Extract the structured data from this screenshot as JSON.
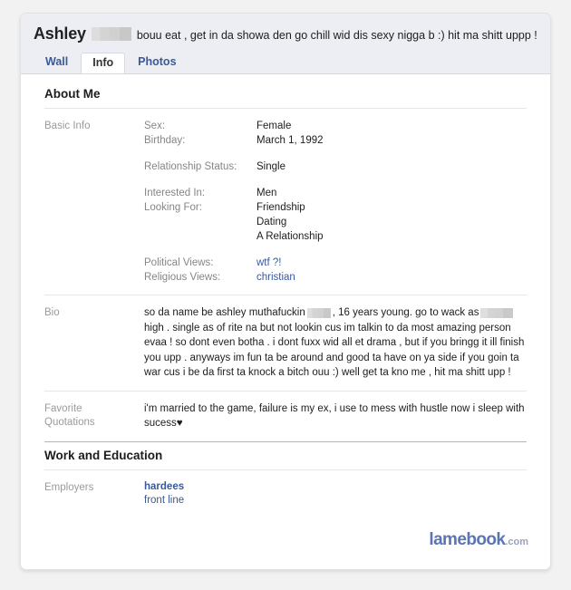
{
  "profile": {
    "name": "Ashley",
    "status_text": "bouu eat , get in da showa den go chill wid dis sexy nigga b :) hit ma shitt uppp !"
  },
  "tabs": [
    {
      "label": "Wall",
      "active": false
    },
    {
      "label": "Info",
      "active": true
    },
    {
      "label": "Photos",
      "active": false
    }
  ],
  "sections": {
    "about_me": {
      "title": "About Me",
      "basic_info": {
        "label": "Basic Info",
        "fields": [
          {
            "key": "Sex:",
            "value": "Female"
          },
          {
            "key": "Birthday:",
            "value": "March 1, 1992"
          },
          {
            "key": "Relationship Status:",
            "value": "Single"
          },
          {
            "key": "Interested In:",
            "value": "Men"
          },
          {
            "key": "Looking For:",
            "value": "Friendship"
          },
          {
            "key": "",
            "value": "Dating"
          },
          {
            "key": "",
            "value": "A Relationship"
          },
          {
            "key": "Political Views:",
            "value": "wtf ?!"
          },
          {
            "key": "Religious Views:",
            "value": "christian"
          }
        ]
      },
      "bio": {
        "label": "Bio",
        "part1": "so da name be ashley muthafuckin",
        "part2": ", 16 years young. go to wack as",
        "part3": "high . single as of rite na but not lookin cus im talkin to da most amazing person evaa ! so dont even botha . i dont fuxx wid all et drama , but if you bringg it ill finish you upp . anyways im fun ta be around and good ta have on ya side if you goin ta war cus i be da first ta knock a bitch ouu :) well get ta kno me , hit ma shitt upp !"
      },
      "favorite_quotations": {
        "label_line1": "Favorite",
        "label_line2": "Quotations",
        "text": "i'm married to the game, failure is my ex, i use to mess with hustle now i sleep with sucess♥"
      }
    },
    "work_and_education": {
      "title": "Work and Education",
      "employers": {
        "label": "Employers",
        "name": "hardees",
        "position": "front line"
      }
    }
  },
  "watermark": {
    "brand": "lamebook",
    "tld": ".com"
  },
  "colors": {
    "link": "#3b5998",
    "header_bg": "#eceef4",
    "label_gray": "#9a9a9a",
    "watermark_blue": "#5b74b5"
  }
}
